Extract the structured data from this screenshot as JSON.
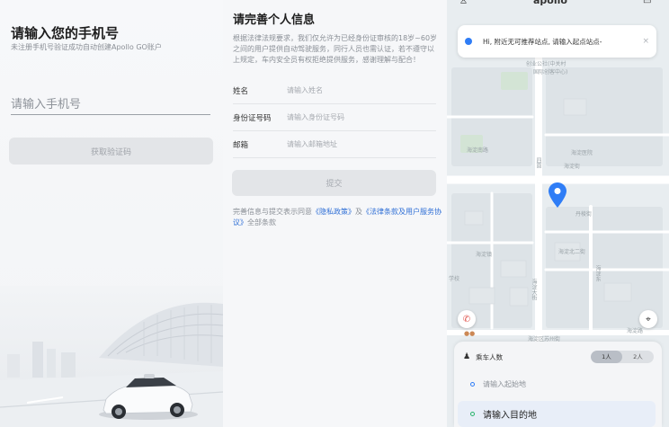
{
  "login": {
    "title": "请输入您的手机号",
    "subtitle": "未注册手机号验证成功自动创建Apollo GO账户",
    "phone_placeholder": "请输入手机号",
    "get_code_label": "获取验证码"
  },
  "profile": {
    "title": "请完善个人信息",
    "notice": "根据法律法规要求，我们仅允许为已经身份证审核的18岁~60岁之间的用户提供自动驾驶服务，同行人员也需认证，若不遵守以上规定，车内安全员有权拒绝提供服务，感谢理解与配合！",
    "fields": [
      {
        "label": "姓名",
        "placeholder": "请输入姓名"
      },
      {
        "label": "身份证号码",
        "placeholder": "请输入身份证号码"
      },
      {
        "label": "邮箱",
        "placeholder": "请输入邮箱地址"
      }
    ],
    "submit_label": "提交",
    "agreement_prefix": "完善信息与提交表示同意",
    "privacy_link": "《隐私政策》",
    "and_text": "及",
    "terms_link": "《法律条款及用户服务协议》",
    "agreement_suffix": "全部条款"
  },
  "map": {
    "brand": "apollo",
    "tip_text": "Hi, 附近无可推荐站点, 请输入起点站点-",
    "tip_close": "×",
    "labels": {
      "l1": "创业公社(中关村",
      "l2": "国际创客中心)",
      "l3": "海淀医院",
      "l4": "丹棱街",
      "l5": "海淀街",
      "l6": "海淀南路",
      "l7": "海淀北二街",
      "l8": "海淀大街",
      "l9": "海淀区苏州街",
      "l10": "四面",
      "l11": "学校",
      "l12": "海淀镇",
      "l13": "海淀东",
      "l14": "海淀路"
    },
    "passenger_label": "乘车人数",
    "passenger_options": [
      "1人",
      "2人"
    ],
    "passenger_selected": "1人",
    "start_placeholder": "请输入起始地",
    "dest_placeholder": "请输入目的地"
  },
  "colors": {
    "accent_blue": "#2f7df6",
    "link_blue": "#2f6fd6",
    "disabled_button": "#e3e5e8"
  }
}
